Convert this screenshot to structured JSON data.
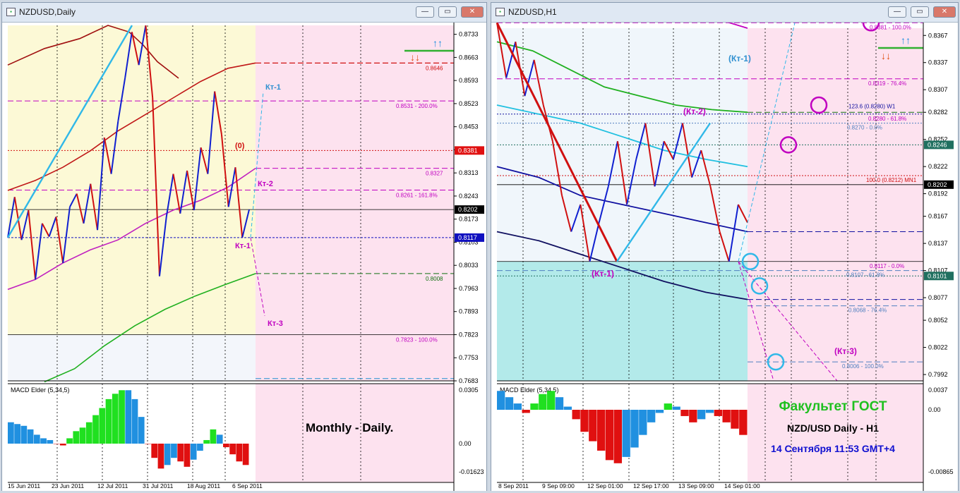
{
  "windows": [
    {
      "title": "NZDUSD,Daily",
      "price_labels": [
        "0.8733",
        "0.8663",
        "0.8593",
        "0.8523",
        "0.8453",
        "0.8383",
        "0.8313",
        "0.8243",
        "0.8173",
        "0.8103",
        "0.8033",
        "0.7963",
        "0.7893",
        "0.7823",
        "0.7753",
        "0.7683"
      ],
      "price_tags": [
        {
          "text": "0.8381",
          "bg": "#e01010",
          "fg": "#ffffff"
        },
        {
          "text": "0.8202",
          "bg": "#000000",
          "fg": "#ffffff"
        },
        {
          "text": "0.8117",
          "bg": "#1010c0",
          "fg": "#ffffff"
        }
      ],
      "level_labels": [
        {
          "text": "0.8646",
          "color": "#d01010"
        },
        {
          "text": "0.8531 - 200.0%",
          "color": "#c000c0"
        },
        {
          "text": "0.8327",
          "color": "#c000c0"
        },
        {
          "text": "0.8261 - 161.8%",
          "color": "#c000c0"
        },
        {
          "text": "0.8008",
          "color": "#107010"
        },
        {
          "text": "0.7823 - 100.0%",
          "color": "#c000c0"
        }
      ],
      "annotations": [
        {
          "text": "Кт-1",
          "color": "#3090d0"
        },
        {
          "text": "(0)",
          "color": "#d01010"
        },
        {
          "text": "Кт-2",
          "color": "#c000c0"
        },
        {
          "text": "Кт-1",
          "color": "#c000c0"
        },
        {
          "text": "Кт-3",
          "color": "#c000c0"
        }
      ],
      "date_labels": [
        "15 Jun 2011",
        "23 Jun 2011",
        "12 Jul 2011",
        "31 Jul 2011",
        "18 Aug 2011",
        "6 Sep 2011"
      ],
      "macd": {
        "label": "MACD Elder (5,34,5)",
        "top": "0.0305",
        "mid": "0.00",
        "bottom": "-0.01623"
      },
      "caption": "Monthly - Daily."
    },
    {
      "title": "NZDUSD,H1",
      "price_labels": [
        "0.8367",
        "0.8337",
        "0.8307",
        "0.8282",
        "0.8252",
        "0.8222",
        "0.8192",
        "0.8167",
        "0.8137",
        "0.8107",
        "0.8077",
        "0.8052",
        "0.8022",
        "0.7992"
      ],
      "price_tags": [
        {
          "text": "0.8246",
          "bg": "#207060",
          "fg": "#ffffff"
        },
        {
          "text": "0.8202",
          "bg": "#000000",
          "fg": "#ffffff"
        },
        {
          "text": "0.8101",
          "bg": "#207060",
          "fg": "#ffffff"
        }
      ],
      "level_labels": [
        {
          "text": "0.8381 - 100.0%",
          "color": "#c000c0"
        },
        {
          "text": "0.8319 - 76.4%",
          "color": "#c000c0"
        },
        {
          "text": "123.6 (0.8280) W1",
          "color": "#1010a0"
        },
        {
          "text": "0.8280 - 61.8%",
          "color": "#c000c0"
        },
        {
          "text": "0.8270 - 0.0%",
          "color": "#5080c0"
        },
        {
          "text": "100.0 (0.8212) MN1",
          "color": "#d01010"
        },
        {
          "text": "0.8117 - 0.0%",
          "color": "#c000c0"
        },
        {
          "text": "0.8107 - 61.8%",
          "color": "#5080c0"
        },
        {
          "text": "0.8068 - 76.4%",
          "color": "#5080c0"
        },
        {
          "text": "0.8006 - 100.0%",
          "color": "#5080c0"
        }
      ],
      "annotations": [
        {
          "text": "(Кт-1)",
          "color": "#3090d0"
        },
        {
          "text": "(Кт-2)",
          "color": "#c000c0"
        },
        {
          "text": "(Кт-1)",
          "color": "#c000c0"
        },
        {
          "text": "(Кт-3)",
          "color": "#c000c0"
        }
      ],
      "date_labels": [
        "8 Sep 2011",
        "9 Sep 09:00",
        "12 Sep 01:00",
        "12 Sep 17:00",
        "13 Sep 09:00",
        "14 Sep 01:00"
      ],
      "macd": {
        "label": "MACD Elder (5,34,5)",
        "top": "0.0037",
        "mid": "0.00",
        "bottom": "-0.00865"
      },
      "caption_1": "Факультет ГОСТ",
      "caption_2": "NZD/USD Daily - H1",
      "caption_3": "14 Сентября 11:53 GMT+4"
    }
  ],
  "chart_data": [
    {
      "type": "line",
      "title": "NZDUSD,Daily",
      "x_ticks": [
        "15 Jun 2011",
        "23 Jun 2011",
        "12 Jul 2011",
        "31 Jul 2011",
        "18 Aug 2011",
        "6 Sep 2011"
      ],
      "ylim": [
        0.7683,
        0.876
      ],
      "series": [
        {
          "values": [
            0.8117,
            0.824,
            0.811,
            0.82,
            0.799,
            0.816,
            0.812,
            0.818,
            0.804,
            0.821,
            0.825,
            0.816,
            0.828,
            0.814,
            0.842,
            0.831,
            0.847,
            0.86,
            0.874,
            0.864,
            0.876,
            0.854,
            0.8,
            0.818,
            0.831,
            0.819,
            0.832,
            0.82,
            0.839,
            0.831,
            0.856,
            0.843,
            0.821,
            0.833,
            0.8117,
            0.8202
          ]
        },
        {
          "values": [
            0.864,
            0.869,
            0.872,
            0.876,
            0.874,
            0.87,
            0.865,
            0.86
          ]
        },
        {
          "values": [
            0.826,
            0.829,
            0.833,
            0.838,
            0.844,
            0.849,
            0.854,
            0.859,
            0.863,
            0.8646
          ]
        },
        {
          "values": [
            0.796,
            0.799,
            0.804,
            0.808,
            0.811,
            0.816,
            0.82,
            0.823,
            0.827,
            0.8327
          ]
        },
        {
          "values": [
            0.768,
            0.772,
            0.779,
            0.785,
            0.79,
            0.794,
            0.7975,
            0.8008
          ]
        }
      ],
      "levels": [
        0.8646,
        0.8531,
        0.8381,
        0.8327,
        0.8261,
        0.8202,
        0.8117,
        0.8008,
        0.7823
      ],
      "macd_values": [
        0.012,
        0.011,
        0.01,
        0.008,
        0.005,
        0.003,
        0.002,
        0.0,
        -0.001,
        0.003,
        0.007,
        0.009,
        0.012,
        0.016,
        0.02,
        0.025,
        0.028,
        0.03,
        0.03,
        0.025,
        0.015,
        0.0,
        -0.008,
        -0.014,
        -0.012,
        -0.008,
        -0.01,
        -0.013,
        -0.009,
        -0.004,
        0.002,
        0.008,
        0.005,
        -0.002,
        -0.006,
        -0.01,
        -0.012
      ]
    },
    {
      "type": "line",
      "title": "NZDUSD,H1",
      "x_ticks": [
        "8 Sep 2011",
        "9 Sep 09:00",
        "12 Sep 01:00",
        "12 Sep 17:00",
        "13 Sep 09:00",
        "14 Sep 01:00"
      ],
      "ylim": [
        0.7985,
        0.8375
      ],
      "series": [
        {
          "values": [
            0.8381,
            0.832,
            0.836,
            0.83,
            0.834,
            0.829,
            0.825,
            0.819,
            0.815,
            0.818,
            0.8117,
            0.816,
            0.82,
            0.825,
            0.818,
            0.823,
            0.827,
            0.82,
            0.825,
            0.823,
            0.827,
            0.821,
            0.824,
            0.82,
            0.815,
            0.8117,
            0.818,
            0.816
          ]
        },
        {
          "values": [
            0.836,
            0.835,
            0.833,
            0.831,
            0.83,
            0.829,
            0.8285,
            0.8282
          ]
        },
        {
          "values": [
            0.829,
            0.828,
            0.827,
            0.8255,
            0.824,
            0.823,
            0.8222
          ]
        },
        {
          "values": [
            0.8222,
            0.821,
            0.819,
            0.818,
            0.817,
            0.816,
            0.815
          ]
        },
        {
          "values": [
            0.815,
            0.814,
            0.8125,
            0.811,
            0.8095,
            0.8083,
            0.8075
          ]
        }
      ],
      "levels": [
        0.8381,
        0.8319,
        0.828,
        0.827,
        0.8246,
        0.8212,
        0.8202,
        0.8117,
        0.8107,
        0.8068,
        0.8006
      ],
      "macd_values": [
        0.003,
        0.002,
        0.001,
        -0.0005,
        0.001,
        0.0025,
        0.003,
        0.002,
        0.0005,
        -0.0015,
        -0.0035,
        -0.005,
        -0.0065,
        -0.008,
        -0.0085,
        -0.0075,
        -0.006,
        -0.004,
        -0.002,
        -0.0005,
        0.001,
        0.0005,
        -0.001,
        -0.002,
        -0.0015,
        -0.0005,
        -0.001,
        -0.002,
        -0.003,
        -0.004
      ]
    }
  ]
}
